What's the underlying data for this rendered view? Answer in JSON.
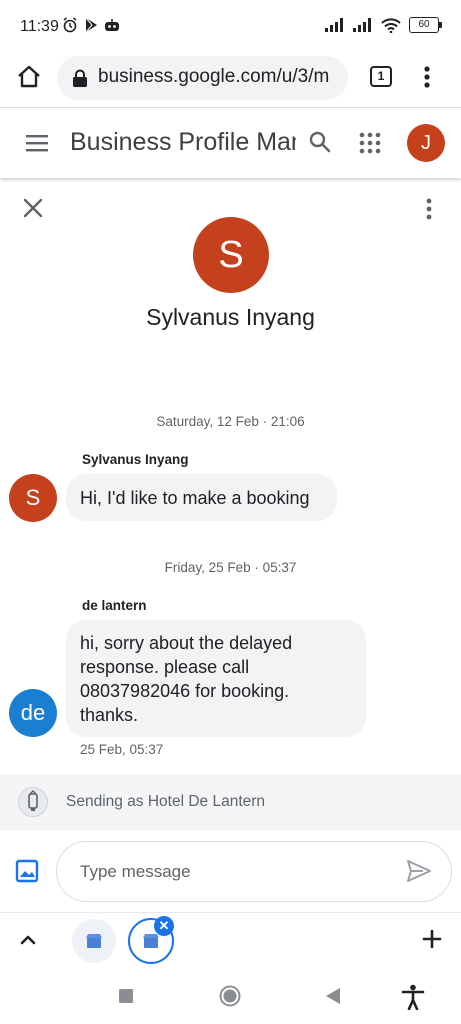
{
  "status_bar": {
    "time": "11:39",
    "battery": "60"
  },
  "browser": {
    "url": "business.google.com/u/3/m",
    "tab_count": "1"
  },
  "app_header": {
    "title": "Business Profile Manager",
    "avatar_letter": "J",
    "avatar_color": "#c5401c"
  },
  "conversation": {
    "contact_initial": "S",
    "contact_name": "Sylvanus Inyang",
    "messages": [
      {
        "date_separator": "Saturday, 12 Feb · 21:06",
        "sender": "Sylvanus Inyang",
        "avatar": "S",
        "text": "Hi, I'd like to make a booking"
      },
      {
        "date_separator": "Friday, 25 Feb · 05:37",
        "sender": "de lantern",
        "avatar": "de",
        "text_lines": [
          "hi, sorry about the delayed",
          "response. please call",
          "08037982046 for booking.",
          "thanks."
        ],
        "timestamp": "25 Feb, 05:37"
      }
    ]
  },
  "composer": {
    "sending_as": "Sending as Hotel De Lantern",
    "placeholder": "Type message"
  },
  "colors": {
    "accent": "#1a73e8",
    "avatar_red": "#c5401c",
    "avatar_blue": "#1a7fd0"
  }
}
